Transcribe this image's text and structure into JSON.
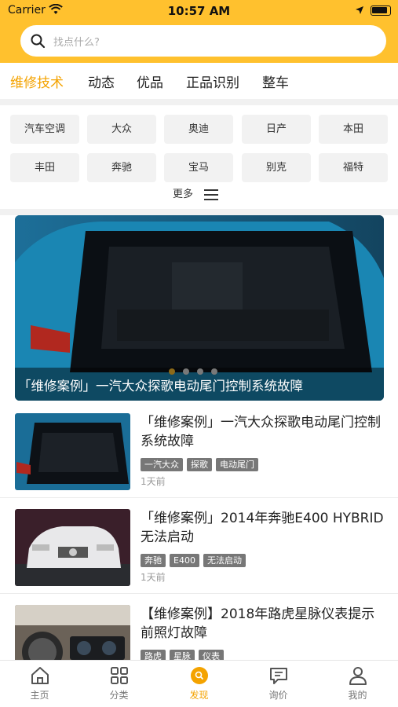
{
  "status_bar": {
    "carrier": "Carrier",
    "time": "10:57 AM"
  },
  "search": {
    "placeholder": "找点什么?"
  },
  "tabs": [
    "维修技术",
    "动态",
    "优品",
    "正品识别",
    "整车"
  ],
  "brands": [
    "汽车空调",
    "大众",
    "奥迪",
    "日产",
    "本田",
    "丰田",
    "奔驰",
    "宝马",
    "别克",
    "福特"
  ],
  "more_label": "更多",
  "banner": {
    "title": "「维修案例」一汽大众探歌电动尾门控制系统故障",
    "slide_count": 4,
    "active_slide": 1
  },
  "articles": [
    {
      "title": "「维修案例」一汽大众探歌电动尾门控制系统故障",
      "tags": [
        "一汽大众",
        "探歌",
        "电动尾门"
      ],
      "date": "1天前"
    },
    {
      "title": "「维修案例」2014年奔驰E400 HYBRID无法启动",
      "tags": [
        "奔驰",
        "E400",
        "无法启动"
      ],
      "date": "1天前"
    },
    {
      "title": "【维修案例】2018年路虎星脉仪表提示前照灯故障",
      "tags": [
        "路虎",
        "星脉",
        "仪表"
      ],
      "date": ""
    }
  ],
  "bottom_nav": [
    "主页",
    "分类",
    "发现",
    "询价",
    "我的"
  ],
  "colors": {
    "accent": "#ffc12e",
    "active_text": "#f4a300"
  }
}
